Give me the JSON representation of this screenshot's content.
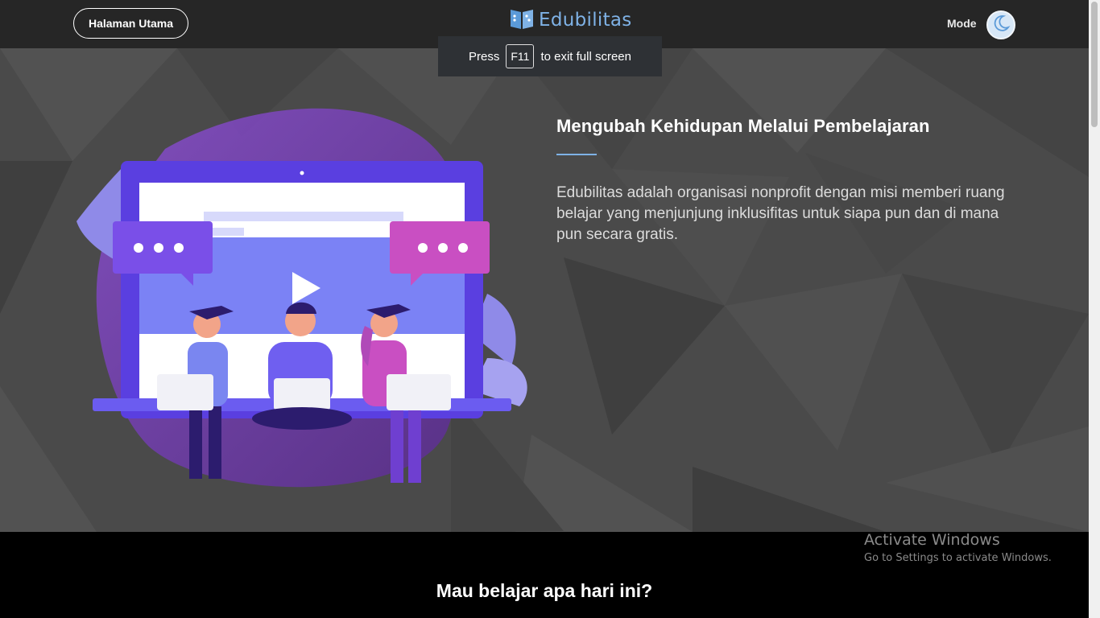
{
  "nav": {
    "home_label": "Halaman Utama",
    "brand": "Edubilitas",
    "mode_label": "Mode",
    "logo_icon": "book-icon",
    "mode_icon": "moon-icon"
  },
  "fullscreen_notice": {
    "prefix": "Press",
    "key": "F11",
    "suffix": "to exit full screen"
  },
  "hero": {
    "title": "Mengubah Kehidupan Melalui Pembelajaran",
    "description": "Edubilitas adalah organisasi nonprofit dengan misi memberi ruang belajar yang menjunjung inklusifitas untuk siapa pun dan di mana pun secara gratis.",
    "illustration": "students-learning-online-illustration"
  },
  "section": {
    "question": "Mau belajar apa hari ini?"
  },
  "windows_watermark": {
    "title": "Activate Windows",
    "subtitle": "Go to Settings to activate Windows."
  },
  "colors": {
    "topbar": "#262626",
    "hero_bg": "#4a4a4a",
    "accent_blue": "#7fb2e6",
    "purple": "#7a5cf0",
    "magenta": "#c94fc2"
  }
}
